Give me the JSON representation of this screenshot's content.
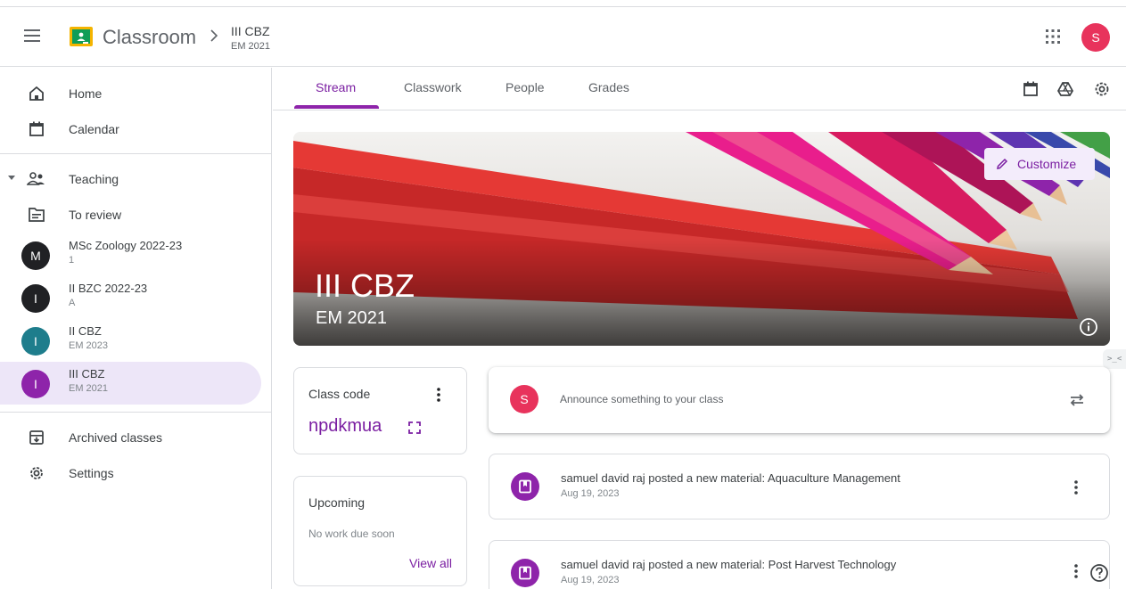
{
  "header": {
    "app_name": "Classroom",
    "class_title": "III CBZ",
    "class_section": "EM 2021",
    "user_initial": "S"
  },
  "sidebar": {
    "home": "Home",
    "calendar": "Calendar",
    "teaching": "Teaching",
    "to_review": "To review",
    "classes": [
      {
        "initial": "M",
        "name": "MSc Zoology 2022-23",
        "section": "1",
        "color": "#202124"
      },
      {
        "initial": "I",
        "name": "II BZC 2022-23",
        "section": "A",
        "color": "#202124"
      },
      {
        "initial": "I",
        "name": "II CBZ",
        "section": "EM 2023",
        "color": "#1e7d8c"
      },
      {
        "initial": "I",
        "name": "III CBZ",
        "section": "EM 2021",
        "color": "#8e24aa"
      }
    ],
    "archived": "Archived classes",
    "settings": "Settings"
  },
  "tabs": {
    "stream": "Stream",
    "classwork": "Classwork",
    "people": "People",
    "grades": "Grades"
  },
  "banner": {
    "title": "III CBZ",
    "section": "EM 2021",
    "customize": "Customize"
  },
  "class_code": {
    "label": "Class code",
    "value": "npdkmua"
  },
  "upcoming": {
    "title": "Upcoming",
    "empty": "No work due soon",
    "view_all": "View all"
  },
  "announce": {
    "initial": "S",
    "placeholder": "Announce something to your class"
  },
  "posts": [
    {
      "title": "samuel david raj posted a new material: Aquaculture Management",
      "date": "Aug 19, 2023"
    },
    {
      "title": "samuel david raj posted a new material: Post Harvest Technology",
      "date": "Aug 19, 2023"
    }
  ],
  "misc": {
    "side_tab": ">_<"
  },
  "colors": {
    "accent": "#7b1fa2",
    "accent_bg": "#ede6f8",
    "user_avatar": "#e8335c"
  }
}
